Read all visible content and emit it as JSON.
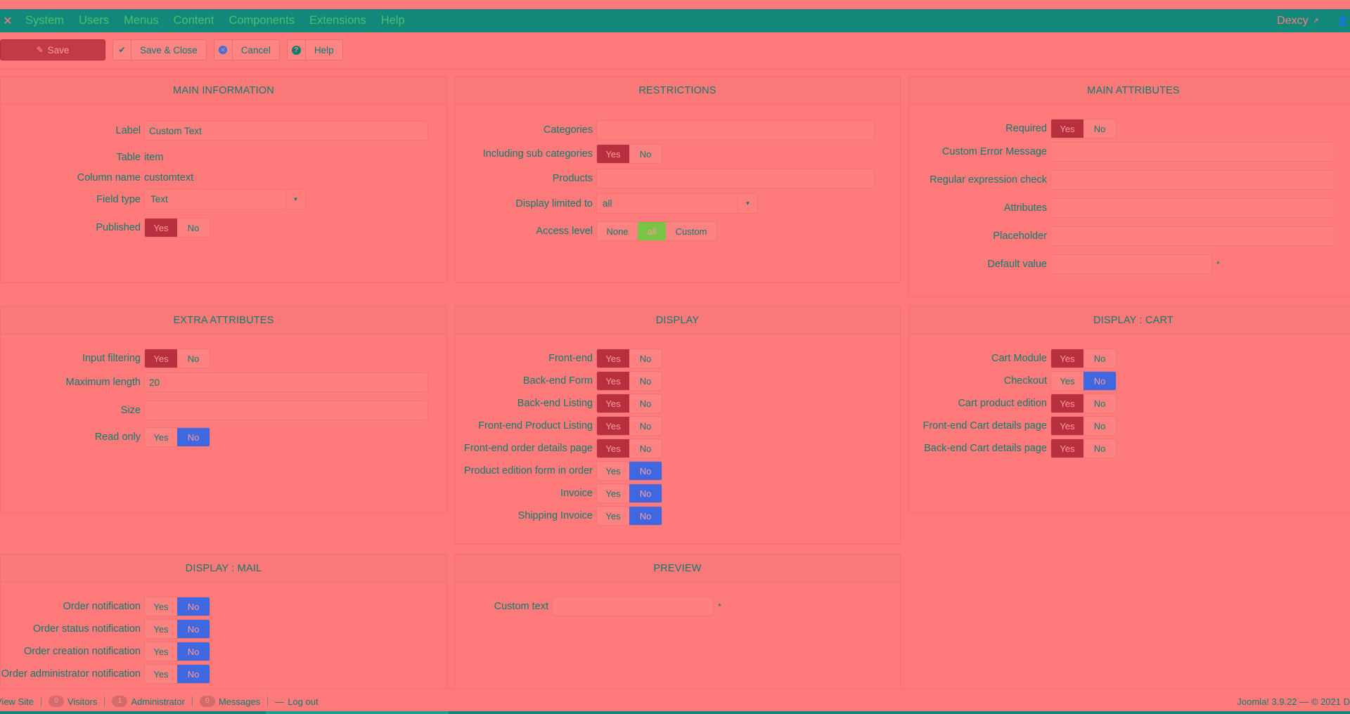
{
  "navbar": {
    "logo_glyph": "✕",
    "menu": [
      "System",
      "Users",
      "Menus",
      "Content",
      "Components",
      "Extensions",
      "Help"
    ],
    "user": "Dexcy",
    "ext_icon": "↗",
    "user_icon": "👤"
  },
  "toolbar": {
    "save_label": "Save",
    "save_close_label": "Save & Close",
    "cancel_label": "Cancel",
    "help_label": "Help",
    "save_icon": "✎",
    "check_icon": "✔",
    "cancel_icon": "✕",
    "help_icon": "?"
  },
  "main_information": {
    "title": "MAIN INFORMATION",
    "label_label": "Label",
    "label_value": "Custom Text",
    "table_label": "Table",
    "table_value": "item",
    "column_label": "Column name",
    "column_value": "customtext",
    "field_type_label": "Field type",
    "field_type_value": "Text",
    "published_label": "Published",
    "published": "Yes"
  },
  "restrictions": {
    "title": "RESTRICTIONS",
    "categories_label": "Categories",
    "sub_categories_label": "Including sub categories",
    "sub_categories": "Yes",
    "products_label": "Products",
    "display_limited_label": "Display limited to",
    "display_limited_value": "all",
    "access_level_label": "Access level",
    "access_options": [
      "None",
      "all",
      "Custom"
    ],
    "access_selected": "all"
  },
  "main_attributes": {
    "title": "MAIN ATTRIBUTES",
    "required_label": "Required",
    "required": "Yes",
    "custom_error_label": "Custom Error Message",
    "regex_label": "Regular expression check",
    "attributes_label": "Attributes",
    "placeholder_label": "Placeholder",
    "default_value_label": "Default value",
    "asterisk": "*"
  },
  "extra_attributes": {
    "title": "EXTRA ATTRIBUTES",
    "input_filtering_label": "Input filtering",
    "input_filtering": "Yes",
    "max_length_label": "Maximum length",
    "max_length_value": "20",
    "size_label": "Size",
    "read_only_label": "Read only",
    "read_only": "No"
  },
  "display": {
    "title": "DISPLAY",
    "rows": [
      {
        "label": "Front-end",
        "value": "Yes"
      },
      {
        "label": "Back-end Form",
        "value": "Yes"
      },
      {
        "label": "Back-end Listing",
        "value": "Yes"
      },
      {
        "label": "Front-end Product Listing",
        "value": "Yes"
      },
      {
        "label": "Front-end order details page",
        "value": "Yes"
      },
      {
        "label": "Product edition form in order",
        "value": "No"
      },
      {
        "label": "Invoice",
        "value": "No"
      },
      {
        "label": "Shipping Invoice",
        "value": "No"
      }
    ]
  },
  "display_cart": {
    "title": "DISPLAY : CART",
    "rows": [
      {
        "label": "Cart Module",
        "value": "Yes"
      },
      {
        "label": "Checkout",
        "value": "No"
      },
      {
        "label": "Cart product edition",
        "value": "Yes"
      },
      {
        "label": "Front-end Cart details page",
        "value": "Yes"
      },
      {
        "label": "Back-end Cart details page",
        "value": "Yes"
      }
    ]
  },
  "display_mail": {
    "title": "DISPLAY : MAIL",
    "rows": [
      {
        "label": "Order notification",
        "value": "No"
      },
      {
        "label": "Order status notification",
        "value": "No"
      },
      {
        "label": "Order creation notification",
        "value": "No"
      },
      {
        "label": "Order administrator notification",
        "value": "No"
      }
    ]
  },
  "preview": {
    "title": "PREVIEW",
    "custom_text_label": "Custom text",
    "asterisk": "*"
  },
  "toggle_labels": {
    "yes": "Yes",
    "no": "No"
  },
  "footer": {
    "view_site": "View Site",
    "visitors_count": "0",
    "visitors_label": "Visitors",
    "admin_count": "1",
    "admin_label": "Administrator",
    "messages_count": "0",
    "messages_label": "Messages",
    "logout_icon": "—",
    "logout_label": "Log out",
    "version": "Joomla! 3.9.22  —  © 2021 D"
  }
}
